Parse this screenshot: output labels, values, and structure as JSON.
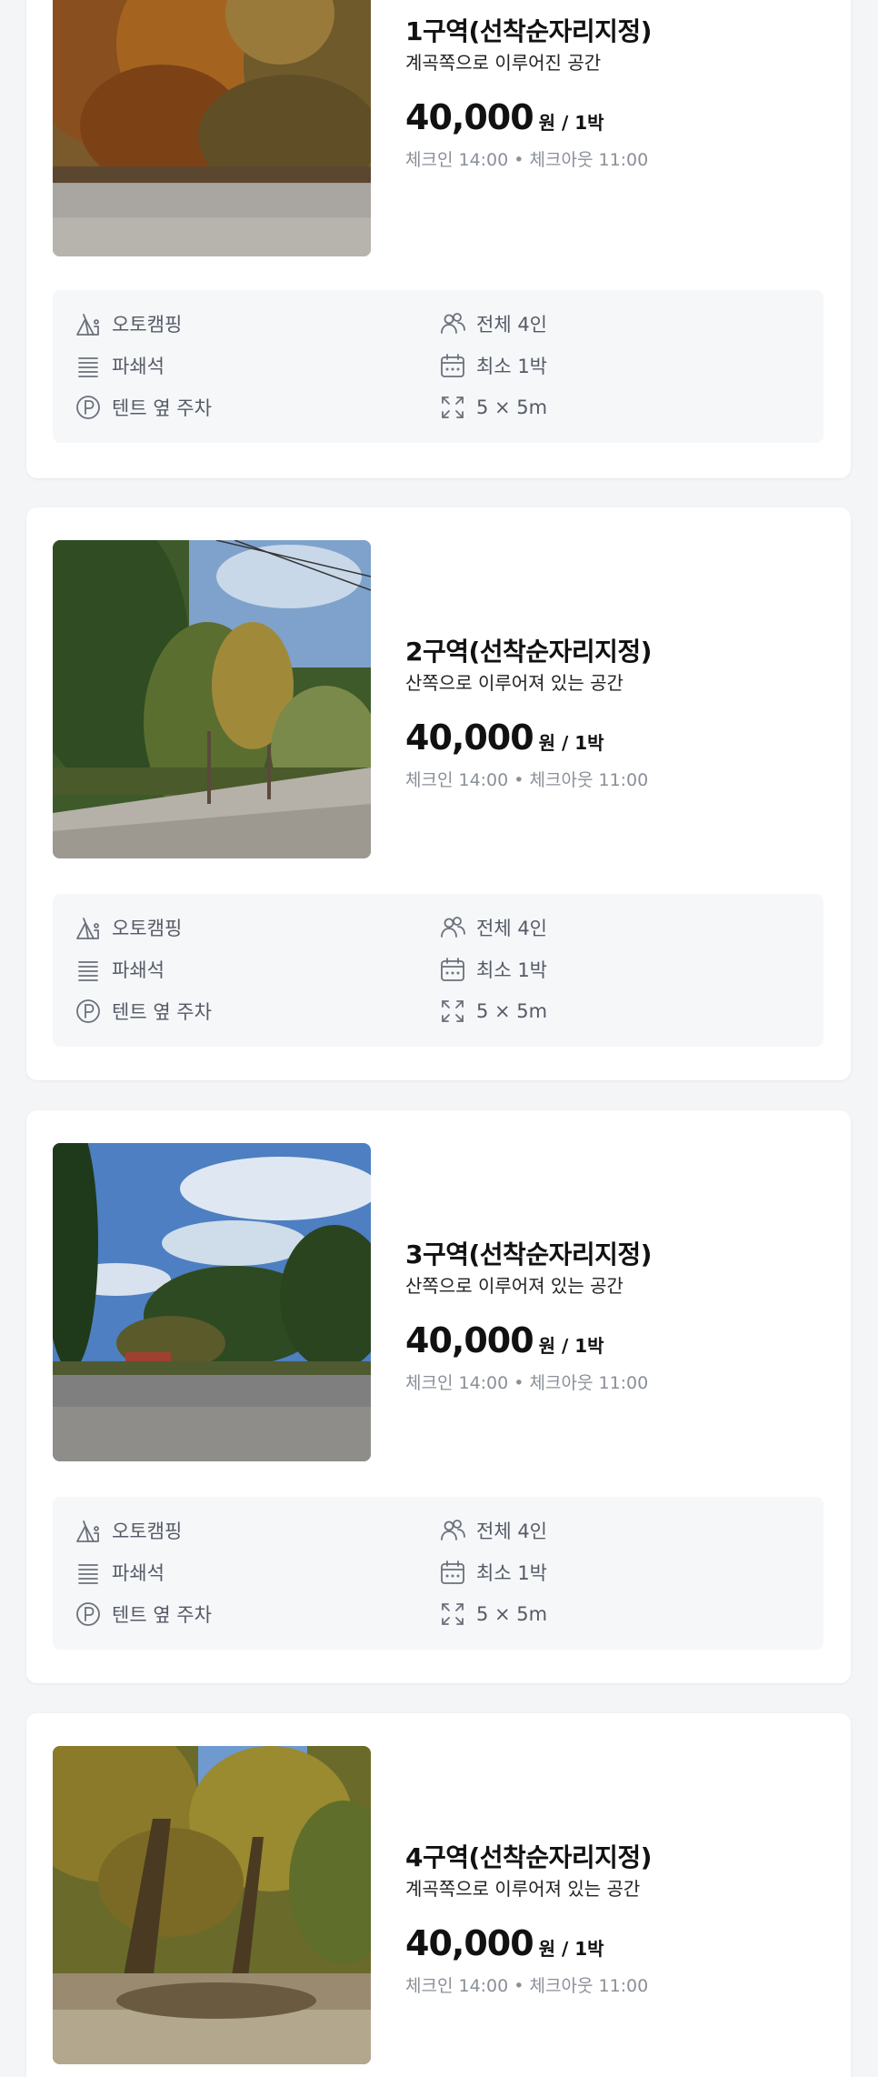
{
  "colors": {
    "page_bg": "#f4f5f7",
    "card_bg": "#ffffff",
    "amenity_bg": "#f6f7f9",
    "muted_text": "#8a8f98",
    "amenity_text": "#555b66",
    "icon_stroke": "#6b717b"
  },
  "sites": [
    {
      "name": "1구역(선착순자리지정)",
      "description": "계곡쪽으로 이루어진 공간",
      "price": "40,000",
      "unit": "원 / 1박",
      "checkin": "체크인 14:00 • 체크아웃 11:00",
      "photo_icon": "autumn-forest-gravel-photo",
      "amenities": {
        "type": "오토캠핑",
        "capacity": "전체 4인",
        "floor": "파쇄석",
        "min_stay": "최소 1박",
        "parking": "텐트 옆 주차",
        "size": "5 × 5m"
      }
    },
    {
      "name": "2구역(선착순자리지정)",
      "description": "산쪽으로 이루어져 있는 공간",
      "price": "40,000",
      "unit": "원 / 1박",
      "checkin": "체크인 14:00 • 체크아웃 11:00",
      "photo_icon": "mountain-forest-path-photo",
      "amenities": {
        "type": "오토캠핑",
        "capacity": "전체 4인",
        "floor": "파쇄석",
        "min_stay": "최소 1박",
        "parking": "텐트 옆 주차",
        "size": "5 × 5m"
      }
    },
    {
      "name": "3구역(선착순자리지정)",
      "description": "산쪽으로 이루어져 있는 공간",
      "price": "40,000",
      "unit": "원 / 1박",
      "checkin": "체크인 14:00 • 체크아웃 11:00",
      "photo_icon": "sky-pine-gravel-photo",
      "amenities": {
        "type": "오토캠핑",
        "capacity": "전체 4인",
        "floor": "파쇄석",
        "min_stay": "최소 1박",
        "parking": "텐트 옆 주차",
        "size": "5 × 5m"
      }
    },
    {
      "name": "4구역(선착순자리지정)",
      "description": "계곡쪽으로 이루어져 있는 공간",
      "price": "40,000",
      "unit": "원 / 1박",
      "checkin": "체크인 14:00 • 체크아웃 11:00",
      "photo_icon": "leafy-trees-photo"
    }
  ]
}
